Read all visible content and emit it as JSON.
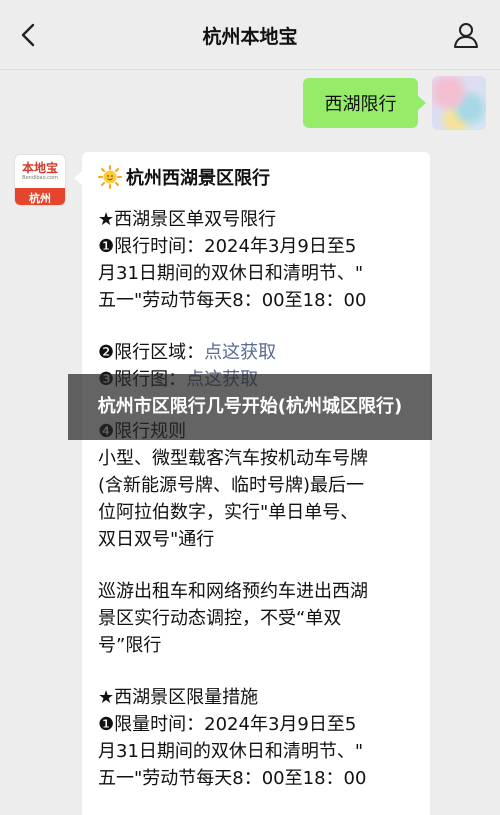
{
  "header": {
    "title": "杭州本地宝",
    "back_icon": "chevron-left-icon",
    "profile_icon": "person-icon"
  },
  "user_message": {
    "text": "西湖限行"
  },
  "bot": {
    "logo_text": "本地宝",
    "logo_domain": "Bendibao.com",
    "logo_city": "杭州"
  },
  "bot_message": {
    "title": "杭州西湖景区限行",
    "lines": [
      "★西湖景区单双号限行",
      "❶限行时间：2024年3月9日至5",
      "月31日期间的双休日和清明节、\"",
      "五一\"劳动节每天8：00至18：00",
      "",
      "❷限行区域：",
      "点这获取",
      "❸限行图：",
      "点这获取",
      "",
      "❹限行规则",
      "小型、微型载客汽车按机动车号牌",
      "(含新能源号牌、临时号牌)最后一",
      "位阿拉伯数字，实行\"单日单号、",
      "双日双号\"通行",
      "",
      "巡游出租车和网络预约车进出西湖",
      "景区实行动态调控，不受“单双",
      "号”限行",
      "",
      "★西湖景区限量措施",
      "❶限量时间：2024年3月9日至5",
      "月31日期间的双休日和清明节、\"",
      "五一\"劳动节每天8：00至18：00"
    ]
  },
  "overlay": {
    "text": "杭州市区限行几号开始(杭州城区限行)"
  },
  "colors": {
    "background": "#ededed",
    "user_bubble": "#95ec69",
    "link": "#576b95",
    "logo_red": "#e6452d"
  }
}
